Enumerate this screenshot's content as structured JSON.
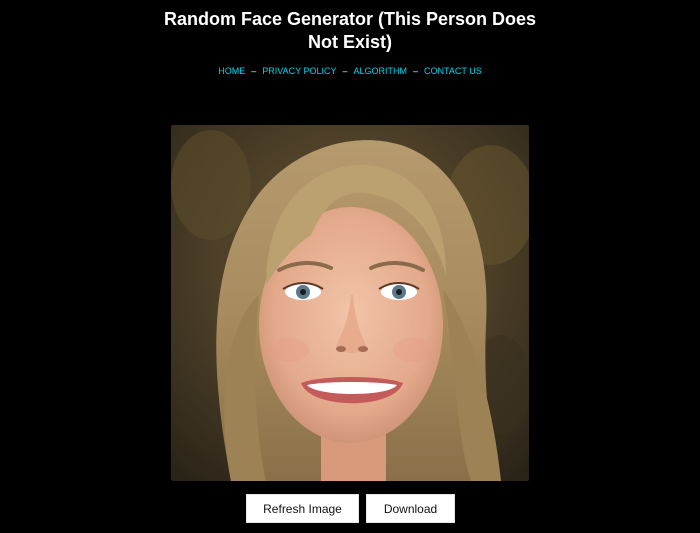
{
  "header": {
    "title": "Random Face Generator (This Person Does Not Exist)"
  },
  "nav": {
    "items": [
      {
        "label": "HOME"
      },
      {
        "label": "PRIVACY POLICY"
      },
      {
        "label": "ALGORITHM"
      },
      {
        "label": "CONTACT US"
      }
    ],
    "separator": "–"
  },
  "actions": {
    "refresh_label": "Refresh Image",
    "download_label": "Download"
  },
  "colors": {
    "background": "#000000",
    "title_text": "#ffffff",
    "nav_link": "#00d4e8",
    "button_bg": "#ffffff",
    "button_text": "#111111"
  }
}
